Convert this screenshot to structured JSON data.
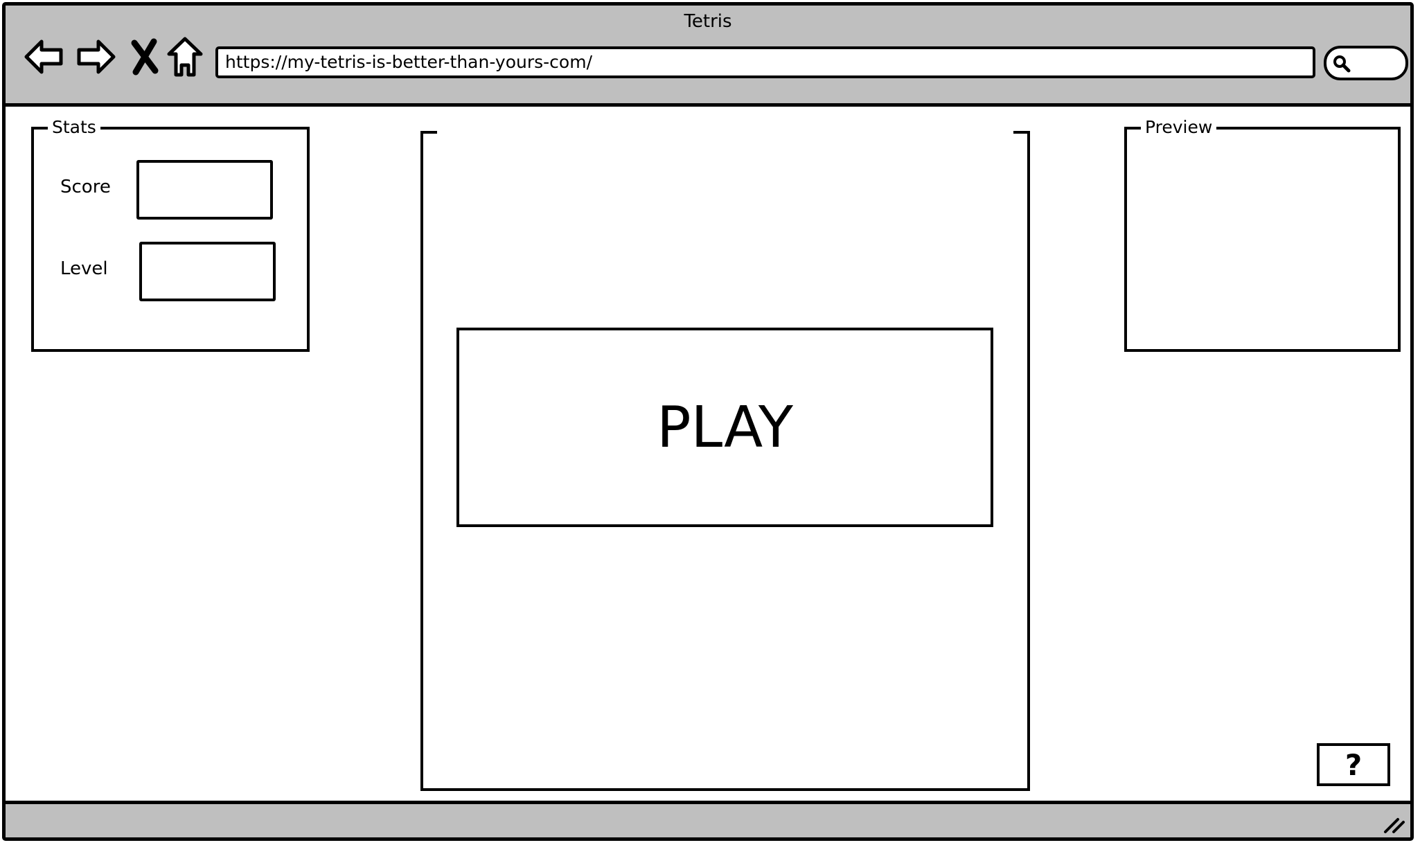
{
  "window": {
    "title": "Tetris"
  },
  "toolbar": {
    "icons": [
      "back-arrow-icon",
      "forward-arrow-icon",
      "close-x-icon",
      "home-icon",
      "search-icon"
    ],
    "url": "https://my-tetris-is-better-than-yours-com/"
  },
  "stats": {
    "legend": "Stats",
    "score_label": "Score",
    "score_value": "",
    "level_label": "Level",
    "level_value": ""
  },
  "preview": {
    "legend": "Preview"
  },
  "board": {
    "play_label": "PLAY"
  },
  "help": {
    "label": "?"
  },
  "colors": {
    "chrome_gray": "#bfbfbf",
    "ink": "#000000",
    "background": "#ffffff"
  }
}
